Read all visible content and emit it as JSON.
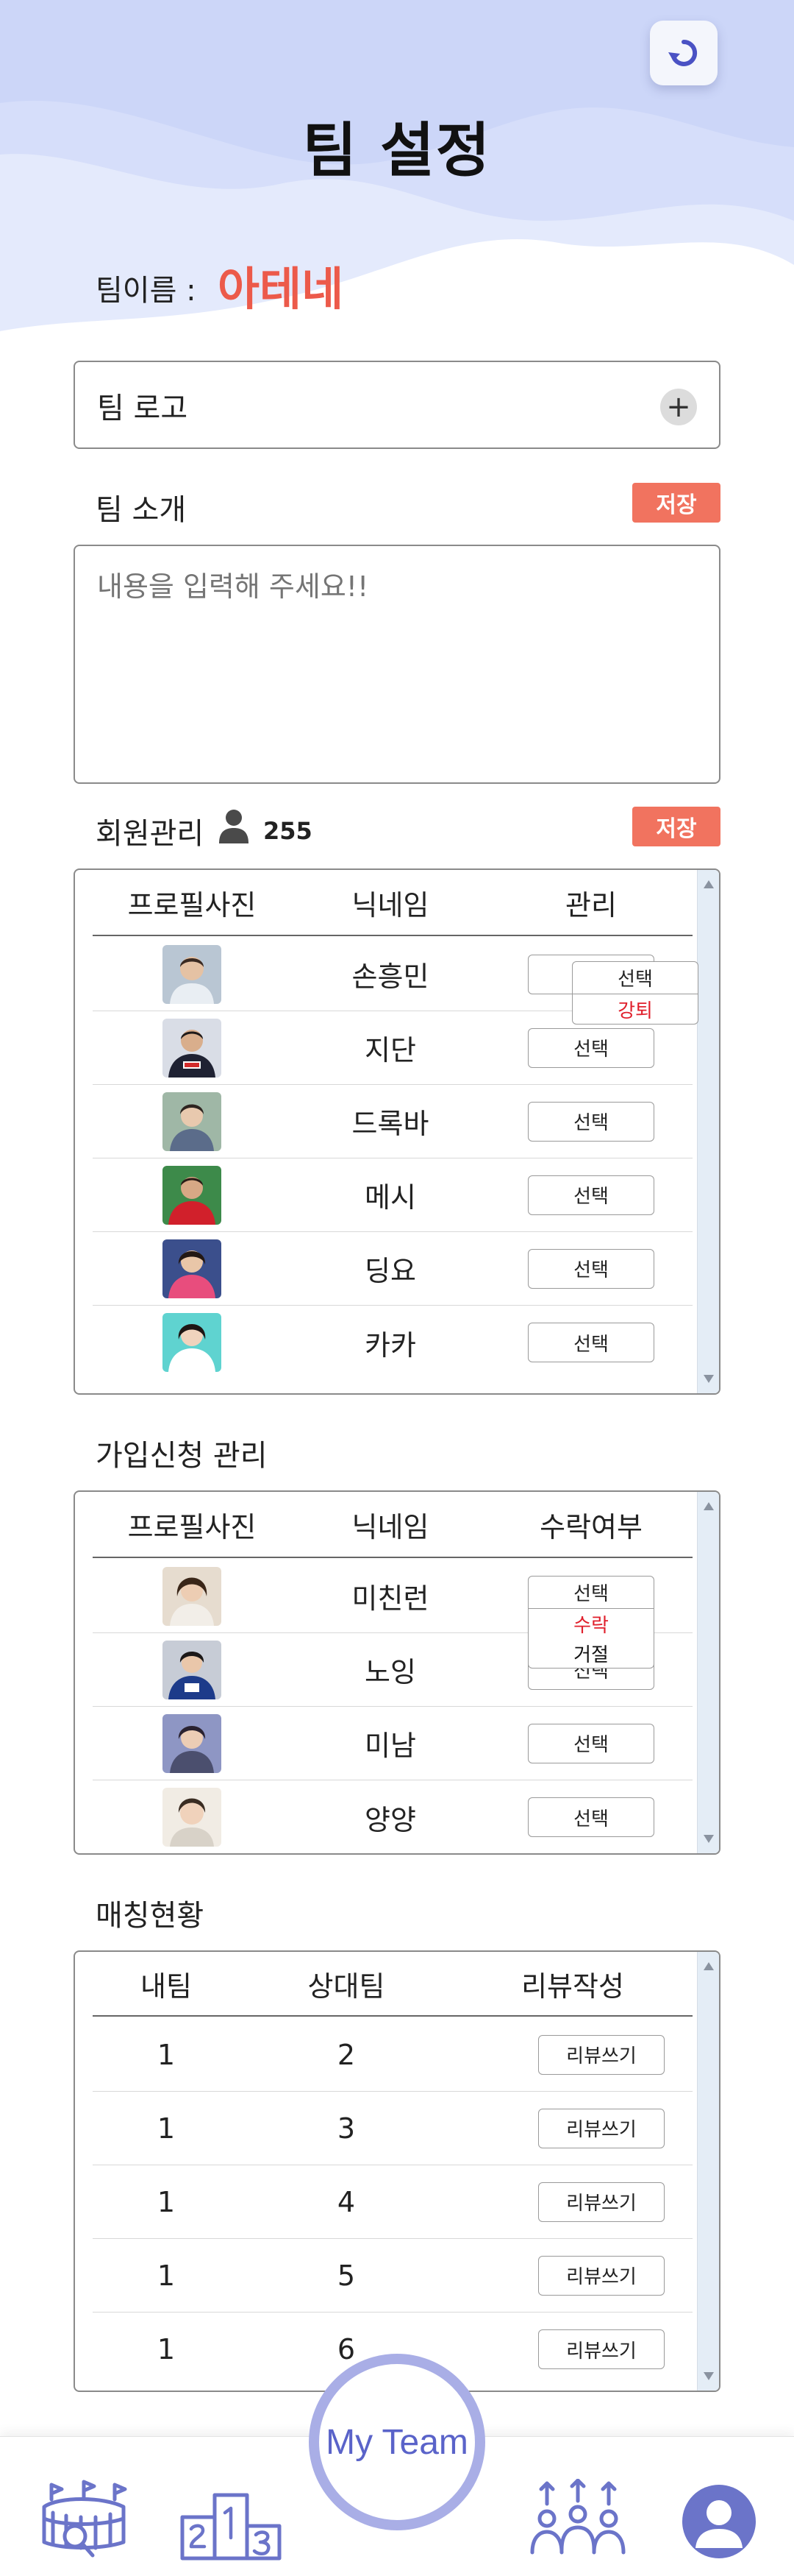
{
  "header": {
    "title": "팀 설정",
    "back_icon": "refresh-back-icon"
  },
  "team": {
    "name_label": "팀이름 :",
    "name_value": "아테네"
  },
  "logo": {
    "label": "팀 로고",
    "add_symbol": "+"
  },
  "intro": {
    "label": "팀 소개",
    "save_label": "저장",
    "placeholder": "내용을 입력해 주세요!!"
  },
  "members": {
    "label": "회원관리",
    "count": "255",
    "save_label": "저장",
    "headers": [
      "프로필사진",
      "닉네임",
      "관리"
    ],
    "rows": [
      {
        "nickname": "손흥민",
        "action": "선택"
      },
      {
        "nickname": "지단",
        "action": "선택"
      },
      {
        "nickname": "드록바",
        "action": "선택"
      },
      {
        "nickname": "메시",
        "action": "선택"
      },
      {
        "nickname": "딩요",
        "action": "선택"
      },
      {
        "nickname": "카카",
        "action": "선택"
      }
    ],
    "dropdown": {
      "selected": "선택",
      "options": [
        "강퇴"
      ]
    }
  },
  "applications": {
    "label": "가입신청 관리",
    "headers": [
      "프로필사진",
      "닉네임",
      "수락여부"
    ],
    "rows": [
      {
        "nickname": "미친런",
        "action": "선택"
      },
      {
        "nickname": "노잉",
        "action": "선택"
      },
      {
        "nickname": "미남",
        "action": "선택"
      },
      {
        "nickname": "양양",
        "action": "선택"
      }
    ],
    "dropdown": {
      "selected": "선택",
      "options": [
        "수락",
        "거절"
      ]
    }
  },
  "matching": {
    "label": "매칭현황",
    "headers": [
      "내팀",
      "상대팀",
      "리뷰작성"
    ],
    "rows": [
      {
        "my_team": "1",
        "opponent": "2",
        "action": "리뷰쓰기"
      },
      {
        "my_team": "1",
        "opponent": "3",
        "action": "리뷰쓰기"
      },
      {
        "my_team": "1",
        "opponent": "4",
        "action": "리뷰쓰기"
      },
      {
        "my_team": "1",
        "opponent": "5",
        "action": "리뷰쓰기"
      },
      {
        "my_team": "1",
        "opponent": "6",
        "action": "리뷰쓰기"
      }
    ]
  },
  "bottom_nav": {
    "center_label": "My Team",
    "items": [
      "stadium-search-icon",
      "podium-ranking-icon",
      "group-people-icon",
      "profile-avatar-icon"
    ]
  },
  "colors": {
    "accent": "#f1735f",
    "team_name": "#ec5a4a",
    "nav_purple": "#5a63c9",
    "hero_bg": "#dbe3fb"
  }
}
